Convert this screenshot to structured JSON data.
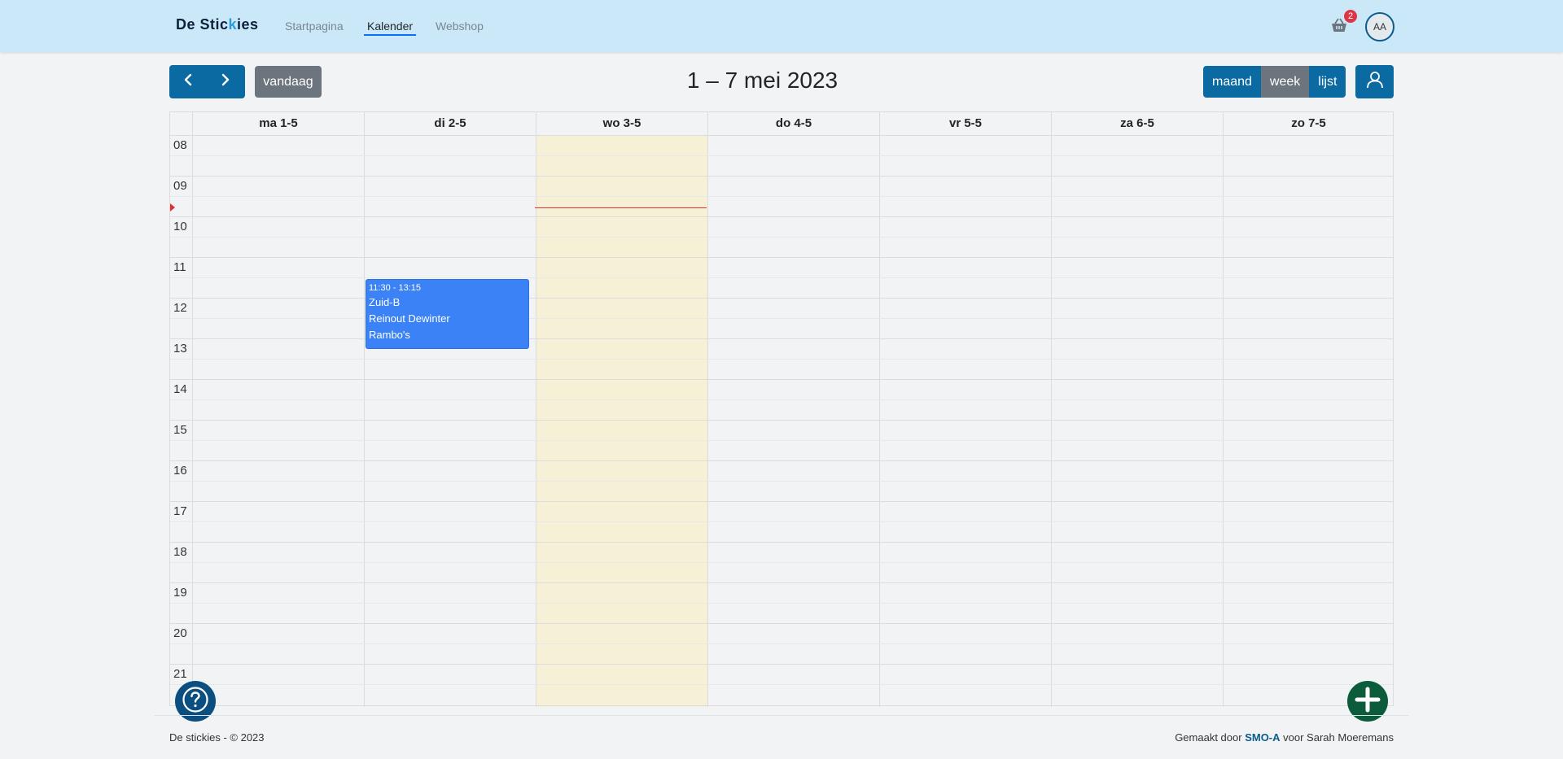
{
  "nav": {
    "brand_part1": "De Stic",
    "brand_part2": "k",
    "brand_part3": "ies",
    "links": [
      "Startpagina",
      "Kalender",
      "Webshop"
    ],
    "active_link": "Kalender",
    "cart_count": "2",
    "avatar_initials": "AA"
  },
  "toolbar": {
    "prev_icon": "chevron-left-icon",
    "next_icon": "chevron-right-icon",
    "today_label": "vandaag",
    "title": "1 – 7 mei 2023",
    "views": [
      "maand",
      "week",
      "lijst"
    ],
    "active_view": "week",
    "user_icon": "user-icon"
  },
  "calendar": {
    "days": [
      "ma 1-5",
      "di 2-5",
      "wo 3-5",
      "do 4-5",
      "vr 5-5",
      "za 6-5",
      "zo 7-5"
    ],
    "today_index": 2,
    "hours": [
      "08",
      "09",
      "10",
      "11",
      "12",
      "13",
      "14",
      "15",
      "16",
      "17",
      "18",
      "19",
      "20",
      "21"
    ],
    "event": {
      "time": "11:30 - 13:15",
      "line1": "Zuid-B",
      "line2": "Reinout Dewinter",
      "line3": "Rambo's",
      "color": "#3b82f6"
    }
  },
  "footer": {
    "left": "De stickies - © 2023",
    "right_prefix": "Gemaakt door",
    "right_org": "SMO-A",
    "right_suffix": "voor Sarah Moeremans"
  },
  "colors": {
    "navbar": "#cbe8f9",
    "primary": "#0a6aa1",
    "today_bg": "#f5f0d6",
    "now_indicator": "#e03131"
  }
}
